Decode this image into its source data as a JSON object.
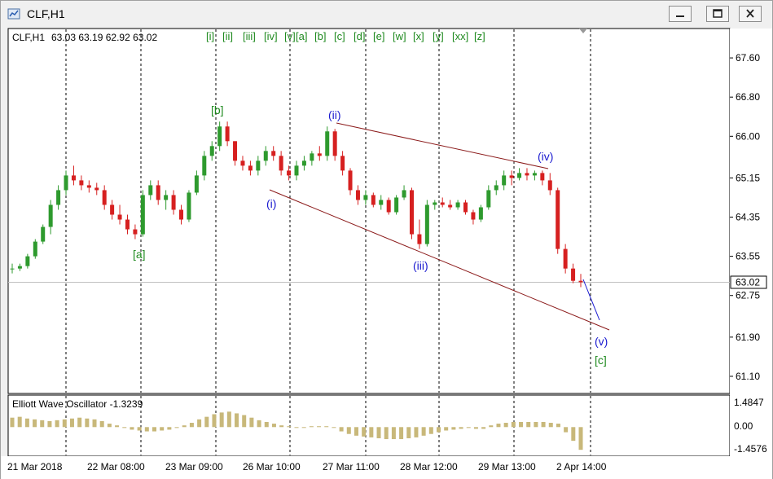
{
  "window": {
    "title": "CLF,H1"
  },
  "chart_header": {
    "symbol": "CLF,H1",
    "ohlc": "63.03 63.19 62.92 63.02"
  },
  "price_axis": {
    "ticks": [
      "67.60",
      "66.80",
      "66.00",
      "65.15",
      "64.35",
      "63.55",
      "62.75",
      "61.90",
      "61.10"
    ],
    "current_price": "63.02"
  },
  "time_axis": {
    "labels": [
      "21 Mar 2018",
      "22 Mar 08:00",
      "23 Mar 09:00",
      "26 Mar 10:00",
      "27 Mar 11:00",
      "28 Mar 12:00",
      "29 Mar 13:00",
      "2 Apr 14:00"
    ]
  },
  "wave_toolbar": [
    "[i]",
    "[ii]",
    "[iii]",
    "[iv]",
    "[v]",
    "[a]",
    "[b]",
    "[c]",
    "[d]",
    "[e]",
    "[w]",
    "[x]",
    "[y]",
    "[xx]",
    "[z]"
  ],
  "wave_labels": {
    "a": "[a]",
    "b": "[b]",
    "c": "[c]",
    "i": "(i)",
    "ii": "(ii)",
    "iii": "(iii)",
    "iv": "(iv)",
    "v": "(v)"
  },
  "oscillator": {
    "title": "Elliott Wave Oscillator -1.3239",
    "ticks": [
      "1.4847",
      "0.00",
      "-1.4576"
    ]
  },
  "colors": {
    "bull": "#2e9a2e",
    "bear": "#d62020",
    "wave_green": "#1f8a1f",
    "wave_blue": "#1a1ad0",
    "channel": "#8b1a1a",
    "osc": "#c8b87a"
  },
  "chart_data": {
    "type": "candlestick",
    "y_range": [
      60.75,
      68.2
    ],
    "candles": [
      [
        63.3,
        63.4,
        63.2,
        63.3
      ],
      [
        63.3,
        63.4,
        63.25,
        63.35
      ],
      [
        63.35,
        63.6,
        63.3,
        63.55
      ],
      [
        63.55,
        63.9,
        63.5,
        63.85
      ],
      [
        63.85,
        64.2,
        63.8,
        64.15
      ],
      [
        64.15,
        64.7,
        64.0,
        64.6
      ],
      [
        64.6,
        65.0,
        64.5,
        64.9
      ],
      [
        64.9,
        65.3,
        64.8,
        65.2
      ],
      [
        65.2,
        65.4,
        65.0,
        65.1
      ],
      [
        65.1,
        65.2,
        64.9,
        65.0
      ],
      [
        65.0,
        65.1,
        64.85,
        64.95
      ],
      [
        64.95,
        65.05,
        64.8,
        64.9
      ],
      [
        64.9,
        65.0,
        64.5,
        64.6
      ],
      [
        64.6,
        64.7,
        64.3,
        64.4
      ],
      [
        64.4,
        64.6,
        64.2,
        64.3
      ],
      [
        64.3,
        64.4,
        64.0,
        64.1
      ],
      [
        64.1,
        64.2,
        63.9,
        64.0
      ],
      [
        64.0,
        64.9,
        63.95,
        64.8
      ],
      [
        64.8,
        65.1,
        64.7,
        65.0
      ],
      [
        65.0,
        65.1,
        64.6,
        64.7
      ],
      [
        64.7,
        64.9,
        64.5,
        64.8
      ],
      [
        64.8,
        64.9,
        64.4,
        64.5
      ],
      [
        64.5,
        64.6,
        64.2,
        64.3
      ],
      [
        64.3,
        64.9,
        64.25,
        64.85
      ],
      [
        64.85,
        65.3,
        64.8,
        65.2
      ],
      [
        65.2,
        65.7,
        65.1,
        65.6
      ],
      [
        65.6,
        65.9,
        65.5,
        65.8
      ],
      [
        65.8,
        66.3,
        65.7,
        66.2
      ],
      [
        66.2,
        66.3,
        65.8,
        65.9
      ],
      [
        65.9,
        65.9,
        65.4,
        65.5
      ],
      [
        65.5,
        65.6,
        65.3,
        65.4
      ],
      [
        65.4,
        65.5,
        65.2,
        65.3
      ],
      [
        65.3,
        65.6,
        65.2,
        65.5
      ],
      [
        65.5,
        65.8,
        65.4,
        65.7
      ],
      [
        65.7,
        65.8,
        65.5,
        65.6
      ],
      [
        65.6,
        65.7,
        65.2,
        65.3
      ],
      [
        65.3,
        65.4,
        65.1,
        65.2
      ],
      [
        65.2,
        65.5,
        65.1,
        65.4
      ],
      [
        65.4,
        65.6,
        65.3,
        65.5
      ],
      [
        65.5,
        65.7,
        65.4,
        65.65
      ],
      [
        65.65,
        65.8,
        65.5,
        65.6
      ],
      [
        65.6,
        66.2,
        65.5,
        66.1
      ],
      [
        66.1,
        66.15,
        65.5,
        65.6
      ],
      [
        65.6,
        65.7,
        65.2,
        65.3
      ],
      [
        65.3,
        65.35,
        64.8,
        64.9
      ],
      [
        64.9,
        65.0,
        64.6,
        64.7
      ],
      [
        64.7,
        64.9,
        64.6,
        64.8
      ],
      [
        64.8,
        64.85,
        64.55,
        64.6
      ],
      [
        64.6,
        64.8,
        64.5,
        64.7
      ],
      [
        64.7,
        64.75,
        64.4,
        64.45
      ],
      [
        64.45,
        64.8,
        64.4,
        64.75
      ],
      [
        64.75,
        65.0,
        64.7,
        64.9
      ],
      [
        64.9,
        64.95,
        63.9,
        64.0
      ],
      [
        64.0,
        64.3,
        63.7,
        63.8
      ],
      [
        63.8,
        64.7,
        63.75,
        64.6
      ],
      [
        64.6,
        64.7,
        64.5,
        64.65
      ],
      [
        64.65,
        64.75,
        64.55,
        64.6
      ],
      [
        64.6,
        64.7,
        64.5,
        64.55
      ],
      [
        64.55,
        64.7,
        64.5,
        64.65
      ],
      [
        64.65,
        64.7,
        64.4,
        64.45
      ],
      [
        64.45,
        64.5,
        64.2,
        64.3
      ],
      [
        64.3,
        64.6,
        64.25,
        64.55
      ],
      [
        64.55,
        65.0,
        64.5,
        64.9
      ],
      [
        64.9,
        65.1,
        64.8,
        65.0
      ],
      [
        65.0,
        65.3,
        64.9,
        65.2
      ],
      [
        65.2,
        65.3,
        65.0,
        65.15
      ],
      [
        65.15,
        65.35,
        65.1,
        65.25
      ],
      [
        65.25,
        65.35,
        65.1,
        65.2
      ],
      [
        65.2,
        65.3,
        65.1,
        65.25
      ],
      [
        65.25,
        65.3,
        65.0,
        65.1
      ],
      [
        65.1,
        65.25,
        64.8,
        64.9
      ],
      [
        64.9,
        64.95,
        63.6,
        63.7
      ],
      [
        63.7,
        63.8,
        63.2,
        63.3
      ],
      [
        63.3,
        63.4,
        63.0,
        63.05
      ],
      [
        63.05,
        63.19,
        62.92,
        63.02
      ]
    ],
    "oscillator_values": [
      0.55,
      0.6,
      0.5,
      0.45,
      0.4,
      0.35,
      0.4,
      0.45,
      0.5,
      0.55,
      0.5,
      0.45,
      0.35,
      0.2,
      0.1,
      -0.05,
      -0.15,
      -0.2,
      -0.25,
      -0.25,
      -0.2,
      -0.15,
      -0.05,
      0.1,
      0.25,
      0.45,
      0.6,
      0.75,
      0.85,
      0.9,
      0.8,
      0.7,
      0.55,
      0.4,
      0.3,
      0.2,
      0.1,
      0.05,
      0.0,
      0.0,
      0.05,
      0.05,
      0.05,
      0.0,
      -0.25,
      -0.4,
      -0.5,
      -0.55,
      -0.6,
      -0.65,
      -0.7,
      -0.7,
      -0.7,
      -0.65,
      -0.6,
      -0.5,
      -0.4,
      -0.3,
      -0.2,
      -0.15,
      -0.1,
      -0.05,
      -0.1,
      -0.1,
      0.1,
      0.2,
      0.25,
      0.3,
      0.3,
      0.3,
      0.3,
      0.3,
      0.25,
      0.2,
      -0.3,
      -0.8,
      -1.3239
    ]
  }
}
